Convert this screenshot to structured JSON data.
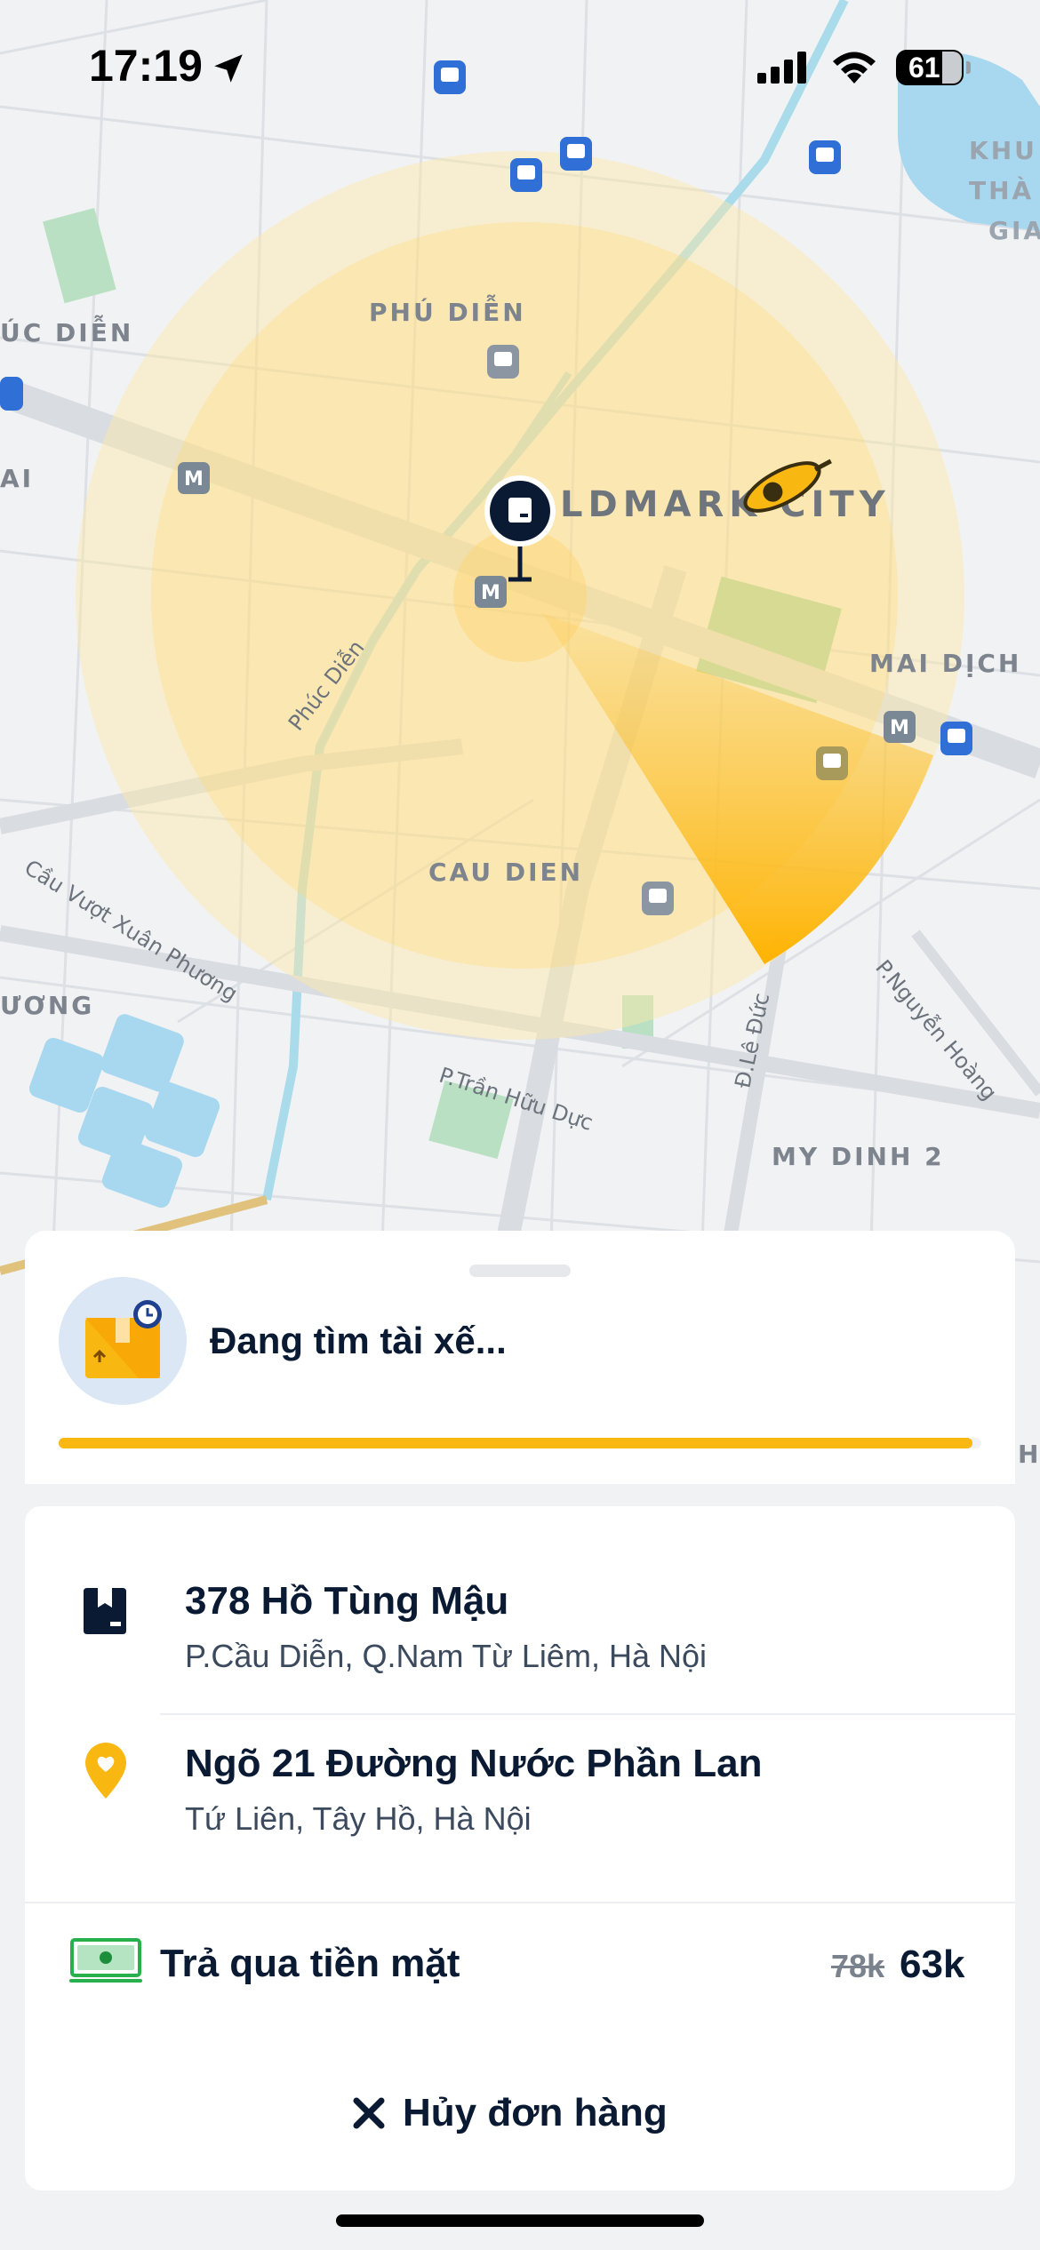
{
  "status_bar": {
    "time": "17:19",
    "battery": "61"
  },
  "map": {
    "labels": {
      "phu_dien": "PHÚ DIỄN",
      "landmark": "LDMARK CITY",
      "mai_dich": "MAI DỊCH",
      "cau_dien": "CAU DIEN",
      "my_dinh_2": "MY DINH 2",
      "uc_dien": "ÚC DIỄN",
      "ai": "AI",
      "uong": "ƯƠNG",
      "khu": "KHU",
      "tha": "THÀ",
      "gia": "GIA",
      "h": "H"
    },
    "streets": {
      "phuc_dien": "Phúc Diễn",
      "cau_vuot": "Cầu Vượt Xuân Phương",
      "tran_huu_duc": "P.Trần Hữu Dực",
      "le_duc": "Đ.Lê Đức",
      "nguyen_hoang": "P.Nguyễn Hoàng"
    }
  },
  "search_card": {
    "status": "Đang tìm tài xế...",
    "progress": 0.99
  },
  "order": {
    "pickup": {
      "title": "378 Hồ Tùng Mậu",
      "address": "P.Cầu Diễn, Q.Nam Từ Liêm, Hà Nội"
    },
    "dropoff": {
      "title": "Ngõ 21 Đường Nước Phần Lan",
      "address": "Tứ Liên, Tây Hồ, Hà Nội"
    },
    "payment": {
      "label": "Trả qua tiền mặt",
      "old_price": "78k",
      "price": "63k"
    },
    "cancel_label": "Hủy đơn hàng"
  },
  "colors": {
    "accent": "#f9b712",
    "navy": "#0b1a33",
    "cash_green": "#27b14c"
  }
}
